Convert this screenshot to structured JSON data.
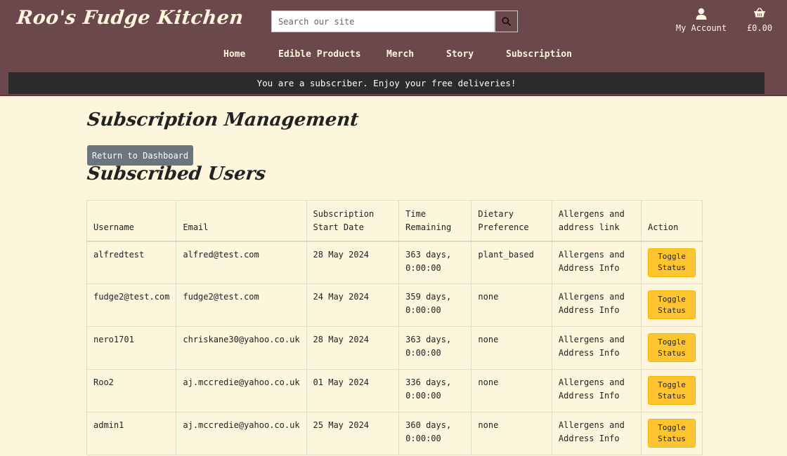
{
  "brand": {
    "name": "Roo's Fudge Kitchen"
  },
  "search": {
    "placeholder": "Search our site"
  },
  "account": {
    "label": "My Account",
    "icon": "user-icon"
  },
  "cart": {
    "label": "£0.00",
    "icon": "basket-icon"
  },
  "nav": {
    "items": [
      "Home",
      "Edible Products",
      "Merch",
      "Story",
      "Subscription"
    ]
  },
  "banner": {
    "text": "You are a subscriber. Enjoy your free deliveries!"
  },
  "page": {
    "title": "Subscription Management",
    "dashboard_button": "Return to Dashboard",
    "section_title": "Subscribed Users"
  },
  "table": {
    "headers": [
      "Username",
      "Email",
      "Subscription Start Date",
      "Time Remaining",
      "Dietary Preference",
      "Allergens and address link",
      "Action"
    ],
    "rows": [
      {
        "username": "alfredtest",
        "email": "alfred@test.com",
        "start": "28 May 2024",
        "remaining": "363 days, 0:00:00",
        "diet": "plant_based",
        "link": "Allergens and Address Info",
        "action": "Toggle Status"
      },
      {
        "username": "fudge2@test.com",
        "email": "fudge2@test.com",
        "start": "24 May 2024",
        "remaining": "359 days, 0:00:00",
        "diet": "none",
        "link": "Allergens and Address Info",
        "action": "Toggle Status"
      },
      {
        "username": "nero1701",
        "email": "chriskane30@yahoo.co.uk",
        "start": "28 May 2024",
        "remaining": "363 days, 0:00:00",
        "diet": "none",
        "link": "Allergens and Address Info",
        "action": "Toggle Status"
      },
      {
        "username": "Roo2",
        "email": "aj.mccredie@yahoo.co.uk",
        "start": "01 May 2024",
        "remaining": "336 days, 0:00:00",
        "diet": "none",
        "link": "Allergens and Address Info",
        "action": "Toggle Status"
      },
      {
        "username": "admin1",
        "email": "aj.mccredie@yahoo.co.uk",
        "start": "25 May 2024",
        "remaining": "360 days, 0:00:00",
        "diet": "none",
        "link": "Allergens and Address Info",
        "action": "Toggle Status"
      }
    ]
  },
  "colors": {
    "header": "#6b484c",
    "background": "#fdf6dc",
    "banner": "#2c2a2a",
    "toggle": "#ffc531",
    "secondary_button": "#6c757d"
  }
}
